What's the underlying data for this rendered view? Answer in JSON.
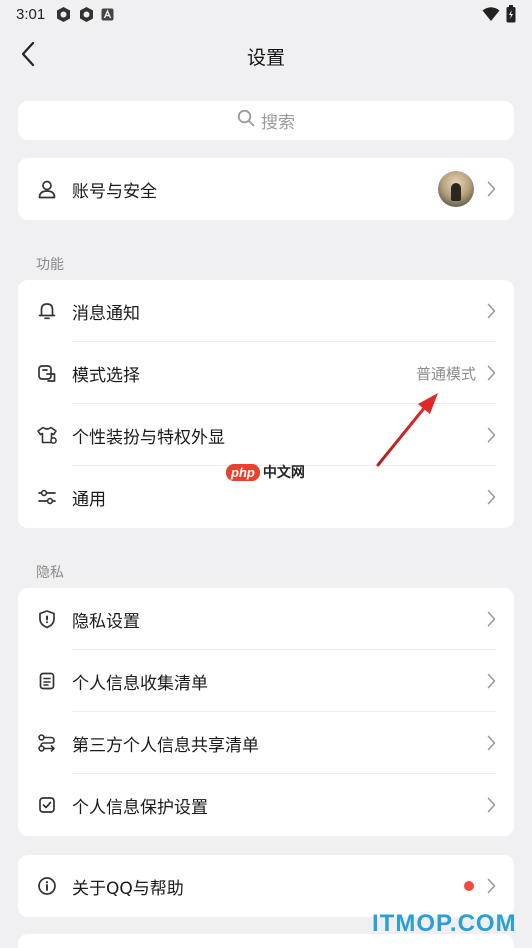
{
  "status_bar": {
    "time": "3:01",
    "icons": [
      "app-badge-icon",
      "app-badge-icon",
      "a-box-icon"
    ],
    "right_icons": [
      "wifi-icon",
      "battery-icon"
    ]
  },
  "nav": {
    "title": "设置",
    "back_icon": "chevron-left-icon"
  },
  "search": {
    "placeholder": "搜索",
    "icon": "search-icon"
  },
  "account": {
    "label": "账号与安全",
    "icon": "user-icon"
  },
  "sections": {
    "features": {
      "label": "功能",
      "items": [
        {
          "label": "消息通知",
          "icon": "bell-icon",
          "value": ""
        },
        {
          "label": "模式选择",
          "icon": "mode-select-icon",
          "value": "普通模式"
        },
        {
          "label": "个性装扮与特权外显",
          "icon": "tshirt-icon",
          "value": ""
        },
        {
          "label": "通用",
          "icon": "sliders-icon",
          "value": ""
        }
      ]
    },
    "privacy": {
      "label": "隐私",
      "items": [
        {
          "label": "隐私设置",
          "icon": "shield-icon"
        },
        {
          "label": "个人信息收集清单",
          "icon": "document-list-icon"
        },
        {
          "label": "第三方个人信息共享清单",
          "icon": "share-flow-icon"
        },
        {
          "label": "个人信息保护设置",
          "icon": "checkbox-icon"
        }
      ]
    }
  },
  "about": {
    "label": "关于QQ与帮助",
    "icon": "info-icon",
    "badge_color": "#f24b3c"
  },
  "watermarks": {
    "php_badge": "php",
    "php_text": "中文网",
    "site": "ITMOP.COM"
  },
  "colors": {
    "background": "#f0f0f2",
    "card": "#ffffff",
    "annotation_arrow": "#e0282a"
  }
}
